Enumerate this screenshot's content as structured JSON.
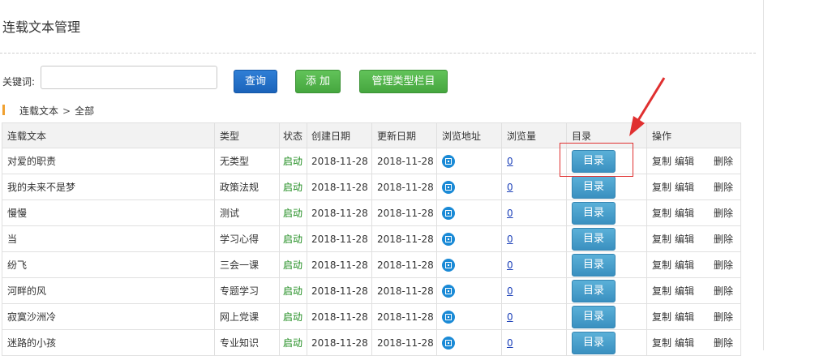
{
  "page": {
    "title": "连载文本管理"
  },
  "search": {
    "label": "关键词:",
    "value": "",
    "placeholder": ""
  },
  "buttons": {
    "query": "查询",
    "add": "添 加",
    "manage": "管理类型栏目"
  },
  "breadcrumb": {
    "root": "连载文本",
    "separator": ">",
    "current": "全部"
  },
  "table": {
    "headers": [
      "连载文本",
      "类型",
      "状态",
      "创建日期",
      "更新日期",
      "浏览地址",
      "浏览量",
      "目录",
      "操作"
    ],
    "dir_label": "目录",
    "ops": {
      "copy": "复制",
      "edit": "编辑",
      "delete": "删除"
    },
    "rows": [
      {
        "title": "对爱的职责",
        "type": "无类型",
        "status": "启动",
        "created": "2018-11-28",
        "updated": "2018-11-28",
        "views": "0"
      },
      {
        "title": "我的未来不是梦",
        "type": "政策法规",
        "status": "启动",
        "created": "2018-11-28",
        "updated": "2018-11-28",
        "views": "0"
      },
      {
        "title": "慢慢",
        "type": "测试",
        "status": "启动",
        "created": "2018-11-28",
        "updated": "2018-11-28",
        "views": "0"
      },
      {
        "title": "当",
        "type": "学习心得",
        "status": "启动",
        "created": "2018-11-28",
        "updated": "2018-11-28",
        "views": "0"
      },
      {
        "title": "纷飞",
        "type": "三会一课",
        "status": "启动",
        "created": "2018-11-28",
        "updated": "2018-11-28",
        "views": "0"
      },
      {
        "title": "河畔的风",
        "type": "专题学习",
        "status": "启动",
        "created": "2018-11-28",
        "updated": "2018-11-28",
        "views": "0"
      },
      {
        "title": "寂寞沙洲冷",
        "type": "网上党课",
        "status": "启动",
        "created": "2018-11-28",
        "updated": "2018-11-28",
        "views": "0"
      },
      {
        "title": "迷路的小孩",
        "type": "专业知识",
        "status": "启动",
        "created": "2018-11-28",
        "updated": "2018-11-28",
        "views": "0"
      }
    ]
  },
  "colors": {
    "status": "#1f8c1f",
    "annotation": "#e03030",
    "query_button": "#1b63ba",
    "add_button": "#45a63f",
    "dir_button": "#3a90c0"
  }
}
